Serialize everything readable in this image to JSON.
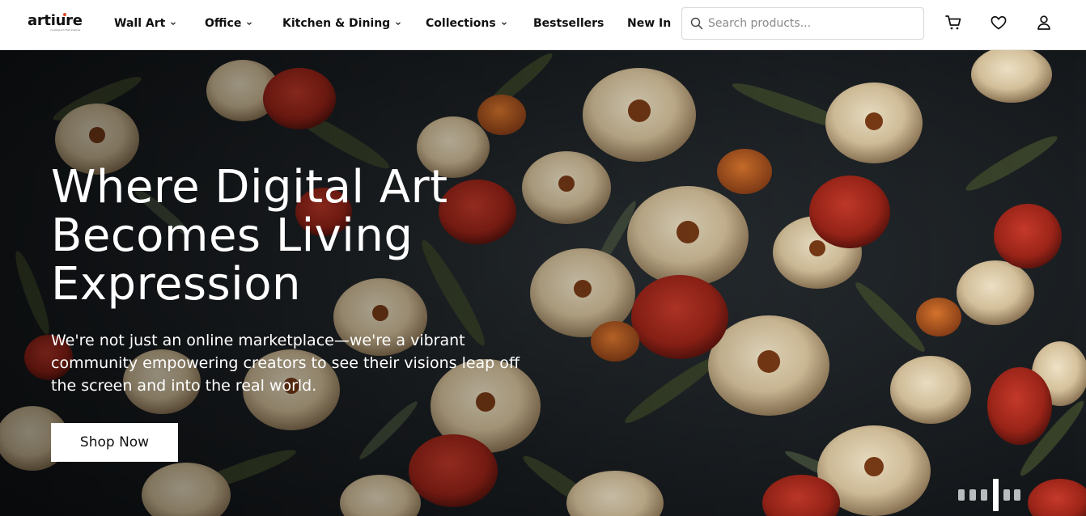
{
  "header": {
    "logo": {
      "word": "artiure",
      "tagline": "curating art that inspires"
    },
    "nav": [
      {
        "label": "Wall Art",
        "has_dropdown": true
      },
      {
        "label": "Office",
        "has_dropdown": true
      },
      {
        "label": "Kitchen & Dining",
        "has_dropdown": true
      },
      {
        "label": "Collections",
        "has_dropdown": true
      },
      {
        "label": "Bestsellers",
        "has_dropdown": false
      },
      {
        "label": "New In",
        "has_dropdown": false
      }
    ],
    "search": {
      "placeholder": "Search products...",
      "value": "",
      "icon": "search-icon"
    },
    "icons": [
      "cart-icon",
      "heart-icon",
      "user-icon"
    ]
  },
  "hero": {
    "title_lines": [
      "Where Digital Art",
      "Becomes Living",
      "Expression"
    ],
    "subtitle_lines": [
      "We're not just an online marketplace—we're a vibrant",
      "community empowering creators to see their visions leap off",
      "the screen and into the real world."
    ],
    "cta_label": "Shop Now",
    "carousel": {
      "slide_count": 6,
      "active_index": 3
    },
    "background": "floral painting"
  },
  "colors": {
    "header_bg": "#ffffff",
    "text": "#111111",
    "hero_text": "#ffffff",
    "button_bg": "#ffffff",
    "logo_accent": "#e04a2a"
  }
}
